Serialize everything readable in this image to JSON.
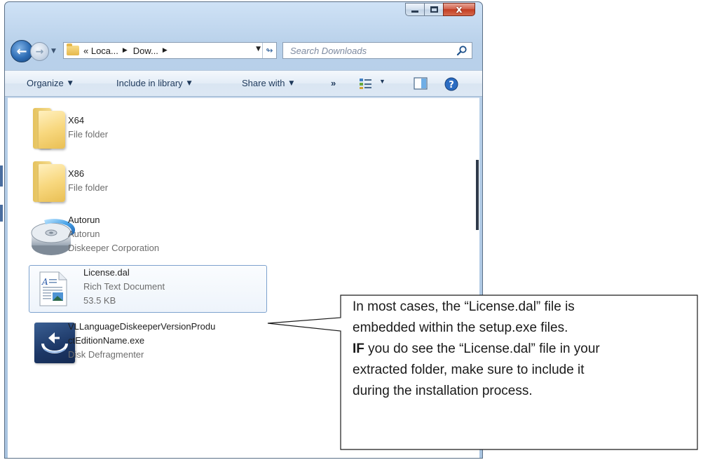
{
  "window": {
    "caption_buttons": [
      "minimize",
      "maximize",
      "close"
    ],
    "close_glyph": "x"
  },
  "nav": {
    "breadcrumbs": [
      "« Loca...",
      "Dow..."
    ],
    "search_placeholder": "Search Downloads"
  },
  "toolbar": {
    "organize": "Organize",
    "include_in_library": "Include in library",
    "share_with": "Share with",
    "more": "»"
  },
  "files": [
    {
      "name": "X64",
      "lines": [
        "File folder"
      ],
      "icon": "folder-icon"
    },
    {
      "name": "X86",
      "lines": [
        "File folder"
      ],
      "icon": "folder-icon"
    },
    {
      "name": "Autorun",
      "lines": [
        "Autorun",
        "Diskeeper Corporation"
      ],
      "icon": "disk-icon"
    },
    {
      "name": "License.dal",
      "lines": [
        "Rich Text Document",
        "53.5 KB"
      ],
      "icon": "rich-text-document-icon",
      "selected": true
    },
    {
      "name_line1": "VLLanguageDiskeeperVersionProdu",
      "name_line2": "ctEditionName.exe",
      "lines": [
        "Disk Defragmenter"
      ],
      "icon": "diskeeper-app-icon"
    }
  ],
  "callout": {
    "line1": "In most cases, the “License.dal” file is",
    "line2": "embedded within the setup.exe files.",
    "line3_bold": "IF",
    "line3_rest": " you do see the “License.dal” file in your",
    "line4": "extracted folder, make sure to include it",
    "line5": "during the installation process."
  },
  "colors": {
    "window_frame": "#b9d1ea",
    "close_button": "#c23c22",
    "toolbar_text": "#1e395b",
    "selection_border": "#7da2ce"
  }
}
